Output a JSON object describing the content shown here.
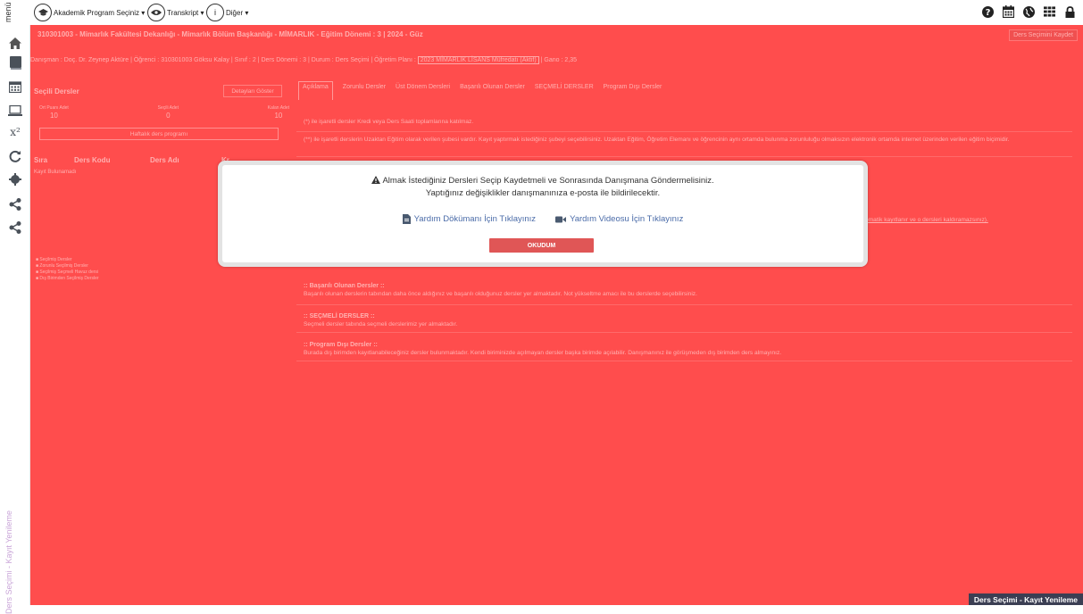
{
  "topbar": {
    "menu_label": "menü",
    "program_btn": "Akademik Program Seçiniz ▾",
    "transcript_btn": "Transkript ▾",
    "other_btn": "Diğer ▾",
    "other_icon_text": "i"
  },
  "header": {
    "program_line": "310301003 - Mimarlık Fakültesi Dekanlığı - Mimarlık Bölüm Başkanlığı - MİMARLIK - Eğitim Dönemi : 3 | 2024 - Güz",
    "save_label": "Ders Seçimini Kaydet",
    "advisor_label": "Danışman :",
    "advisor": "Doç. Dr. Zeynep Aktüre",
    "student_label": "Öğrenci :",
    "student": "310301003 Göksu Kalay",
    "class_label": "Sınıf :",
    "class": "2",
    "term_label": "Ders Dönemi :",
    "term": "3",
    "status_label": "Durum :",
    "status": "Ders Seçimi",
    "plan_label": "Öğretim Planı :",
    "plan": "2023 MİMARLIK LİSANS Müfredatı (Aktif)",
    "gpa_label": "Gano :",
    "gpa": "2,35"
  },
  "left_panel": {
    "title": "Seçili Dersler",
    "details_btn": "Detayları Göster",
    "stats": [
      {
        "label": "Ort Puanı Adet",
        "value": "10"
      },
      {
        "label": "Seçili Adet",
        "value": "0"
      },
      {
        "label": "Kalan Adet",
        "value": "10"
      }
    ],
    "weekly_btn": "Haftalık ders programı",
    "columns": [
      "Sıra",
      "Ders Kodu",
      "Ders Adı",
      "Kr."
    ],
    "empty_text": "Kayıt Bulunamadı",
    "legend": [
      "Seçilmiş Dersler",
      "Zorunlu Seçilmiş Dersler",
      "Seçilmiş Seçmeli Havuz dersi",
      "Dış Birimden Seçilmiş Dersler"
    ]
  },
  "tabs": [
    "Açıklama",
    "Zorunlu Dersler",
    "Üst Dönem Dersleri",
    "Başarılı Olunan Dersler",
    "SEÇMELİ DERSLER",
    "Program Dışı Dersler"
  ],
  "notes": {
    "n1": "(*) ile işaretli dersler Kredi veya Ders Saati toplamlarına katılmaz.",
    "n2": "(**) ile işaretli derslerin Uzaktan Eğitim olarak verilen şubesi vardır. Kayıt yaptırmak istediğiniz şubeyi seçebilirsiniz. Uzaktan Eğitim, Öğretim Elemanı ve öğrencinin aynı ortamda bulunma zorunluluğu olmaksızın elektronik ortamda internet üzerinden verilen eğitim biçimidir.",
    "hidden_link": "a otomatik kayıtlanır ve o dersleri kaldıramazsınız).",
    "s1_title": ":: Başarılı Olunan Dersler ::",
    "s1_text": "Başarılı olunan derslerin tabından daha önce aldığınız ve başarılı olduğunuz dersler yer almaktadır. Not yükseltme amacı ile bu derslerde seçebilirsiniz.",
    "s2_title": ":: SEÇMELİ DERSLER ::",
    "s2_text": "Seçmeli dersler tabında seçmeli derslerimiz yer almaktadır.",
    "s3_title": ":: Program Dışı Dersler ::",
    "s3_text": "Burada dış birimden kayıtlanabileceğiniz dersler bulunmaktadır. Kendi biriminizde açılmayan dersler başka birimde açılabilir. Danışmanınız ile görüşmeden dış birimden ders almayınız."
  },
  "modal": {
    "line1": "Almak İstediğiniz Dersleri Seçip Kaydetmeli ve Sonrasında Danışmana Göndermelisiniz.",
    "line2": "Yaptığınız değişiklikler danışmanınıza e-posta ile bildirilecektir.",
    "doc_link": "Yardım Dökümanı İçin Tıklayınız",
    "video_link": "Yardım Videosu İçin Tıklayınız",
    "ok_btn": "OKUDUM"
  },
  "rail_caption": "Ders Seçimi - Kayıt Yenileme",
  "footer_badge": "Ders Seçimi - Kayıt Yenileme",
  "colors": {
    "overlay_red": "#ff4d4d",
    "ok_button": "#e05656",
    "link_blue": "#4a6ba8",
    "footer_bg": "#3b3e53"
  }
}
